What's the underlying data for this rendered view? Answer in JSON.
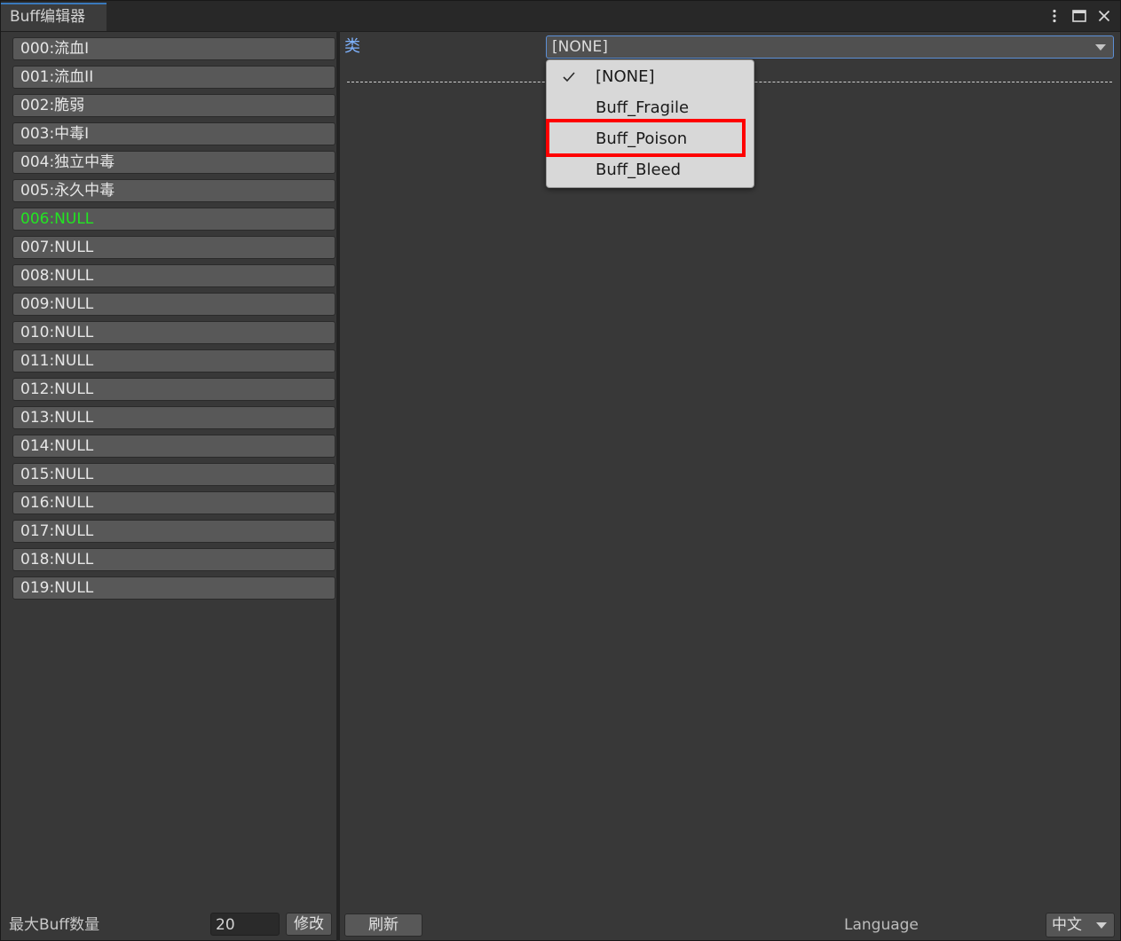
{
  "window": {
    "tab_title": "Buff编辑器",
    "icons": [
      "more-vert-icon",
      "maximize-icon",
      "close-icon"
    ]
  },
  "buff_list": {
    "items": [
      {
        "label": "000:流血I"
      },
      {
        "label": "001:流血II"
      },
      {
        "label": "002:脆弱"
      },
      {
        "label": "003:中毒I"
      },
      {
        "label": "004:独立中毒"
      },
      {
        "label": "005:永久中毒"
      },
      {
        "label": "006:NULL",
        "selected": true
      },
      {
        "label": "007:NULL"
      },
      {
        "label": "008:NULL"
      },
      {
        "label": "009:NULL"
      },
      {
        "label": "010:NULL"
      },
      {
        "label": "011:NULL"
      },
      {
        "label": "012:NULL"
      },
      {
        "label": "013:NULL"
      },
      {
        "label": "014:NULL"
      },
      {
        "label": "015:NULL"
      },
      {
        "label": "016:NULL"
      },
      {
        "label": "017:NULL"
      },
      {
        "label": "018:NULL"
      },
      {
        "label": "019:NULL"
      }
    ],
    "selected_color": "#22e622"
  },
  "left_footer": {
    "max_label": "最大Buff数量",
    "max_value": "20",
    "modify_label": "修改"
  },
  "inspector": {
    "class_label": "类",
    "class_value": "[NONE]"
  },
  "dropdown": {
    "options": [
      {
        "label": "[NONE]",
        "checked": true
      },
      {
        "label": "Buff_Fragile"
      },
      {
        "label": "Buff_Poison",
        "highlighted": true
      },
      {
        "label": "Buff_Bleed"
      }
    ],
    "highlight_color": "#ff0000"
  },
  "right_footer": {
    "refresh_label": "刷新",
    "language_label": "Language",
    "language_value": "中文"
  }
}
